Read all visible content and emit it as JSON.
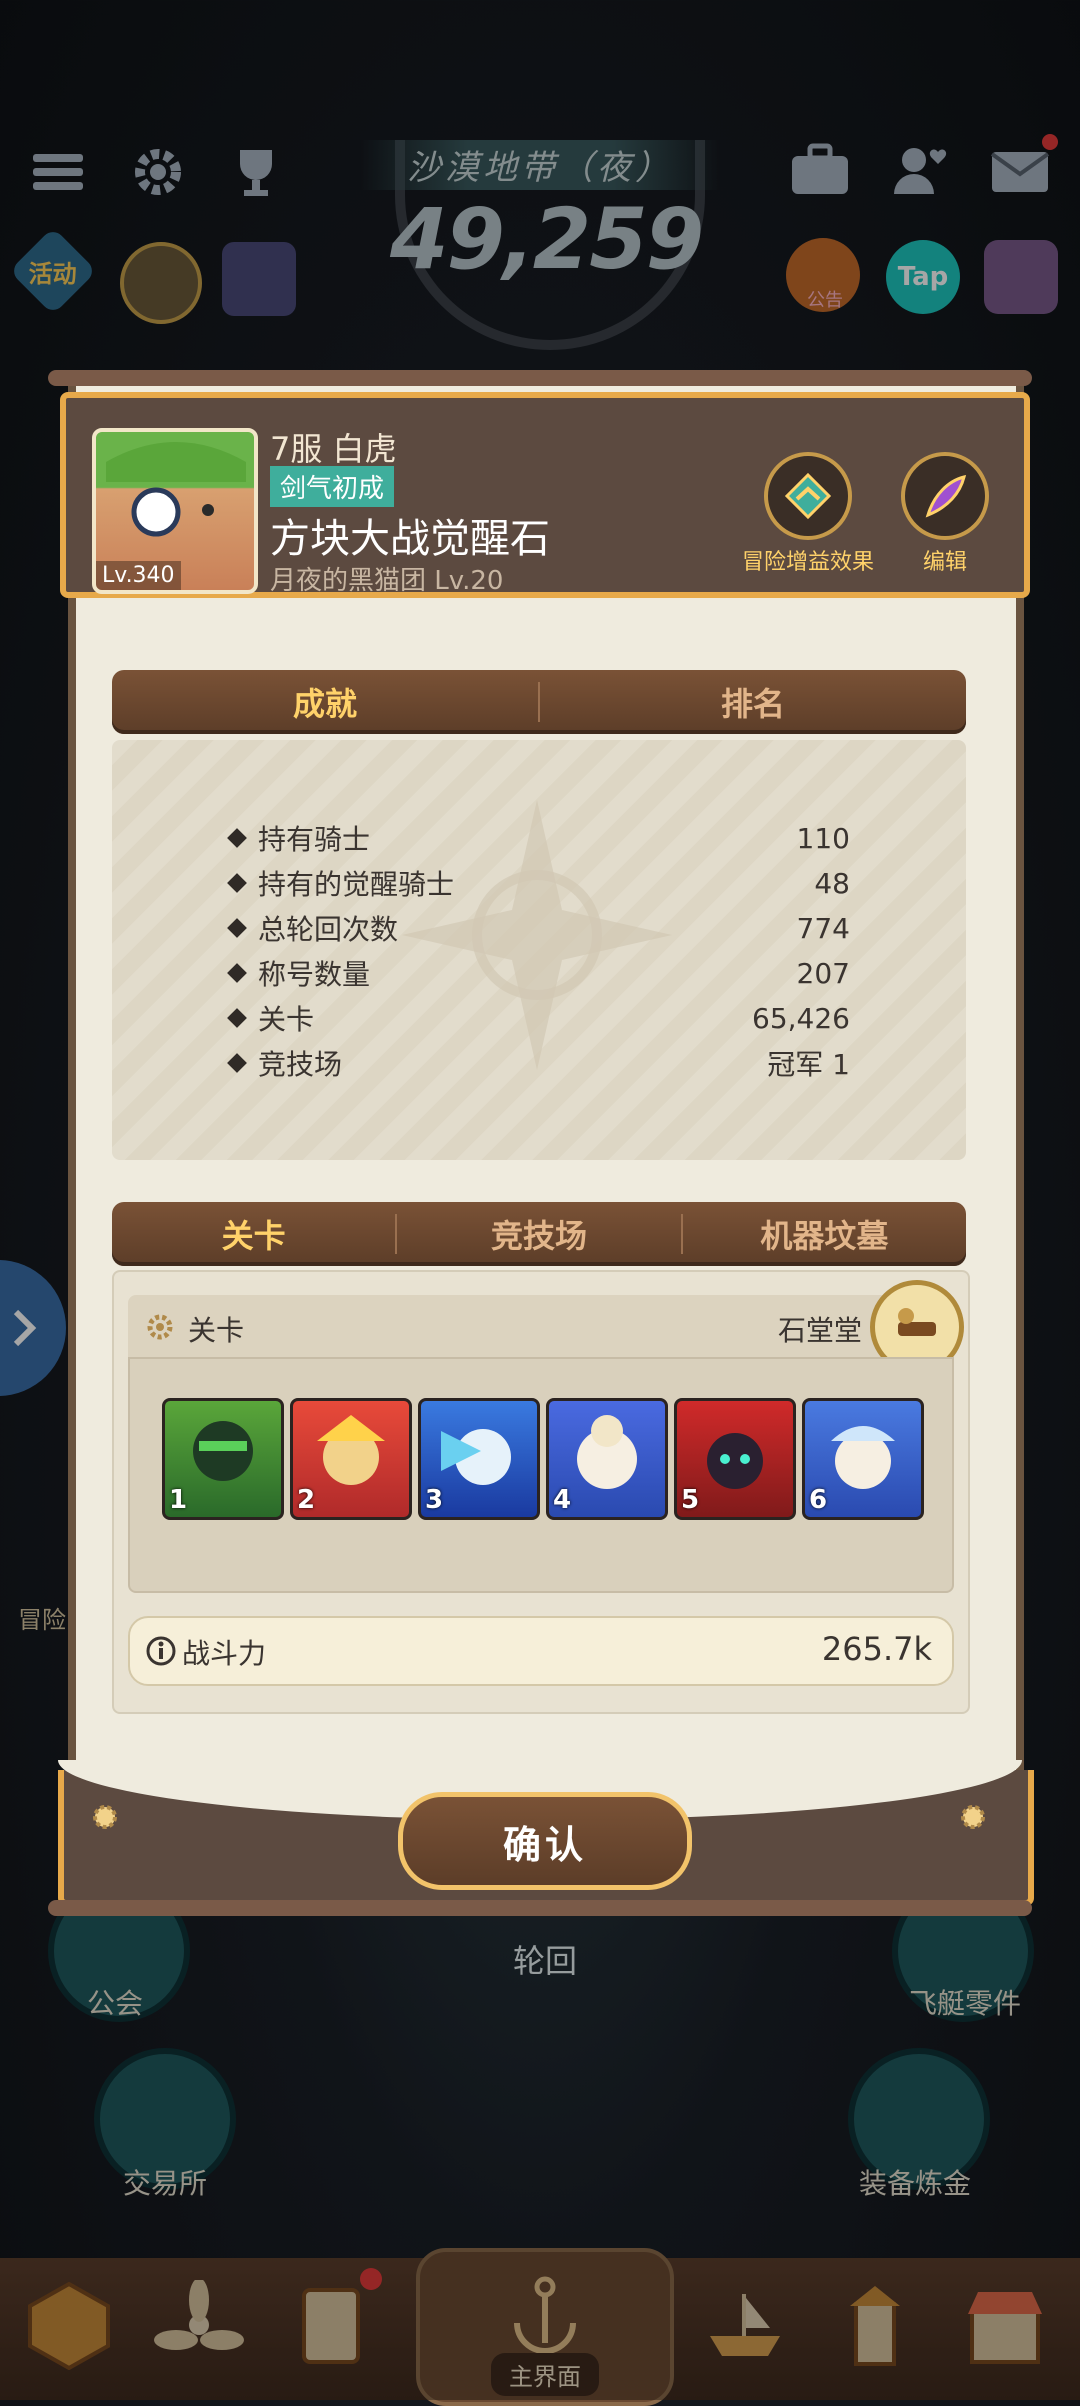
{
  "hud": {
    "zone": "沙漠地带（夜）",
    "score": "49,259",
    "activity_label": "活动",
    "ad_label": "公告",
    "tap_label": "Tap"
  },
  "profile": {
    "server_name": "7服 白虎",
    "title_tag": "剑气初成",
    "nickname": "方块大战觉醒石",
    "guild": "月夜的黑猫团 Lv.20",
    "level": "Lv.340",
    "buff_label": "冒险增益效果",
    "edit_label": "编辑"
  },
  "tabs_top": [
    "成就",
    "排名"
  ],
  "stats": [
    {
      "label": "持有骑士",
      "value": "110"
    },
    {
      "label": "持有的觉醒骑士",
      "value": "48"
    },
    {
      "label": "总轮回次数",
      "value": "774"
    },
    {
      "label": "称号数量",
      "value": "207"
    },
    {
      "label": "关卡",
      "value": "65,426"
    },
    {
      "label": "竞技场",
      "value": "冠军 1"
    }
  ],
  "tabs_bottom": [
    "关卡",
    "竞技场",
    "机器坟墓"
  ],
  "team": {
    "section_label": "关卡",
    "owner": "石堂堂",
    "heroes": [
      "1",
      "2",
      "3",
      "4",
      "5",
      "6"
    ],
    "power_label": "战斗力",
    "power_value": "265.7k"
  },
  "confirm_label": "确认",
  "background_menu": {
    "reincarnation": "轮回",
    "guild": "公会",
    "airship_parts": "飞艇零件",
    "exchange": "交易所",
    "equipment_alchemy": "装备炼金",
    "adventure": "冒险",
    "main_screen": "主界面"
  },
  "colors": {
    "accent_gold": "#e7a94a",
    "panel_brown": "#5c4a40",
    "modal_bg": "#efebde",
    "tag_teal": "#3fae9c"
  }
}
